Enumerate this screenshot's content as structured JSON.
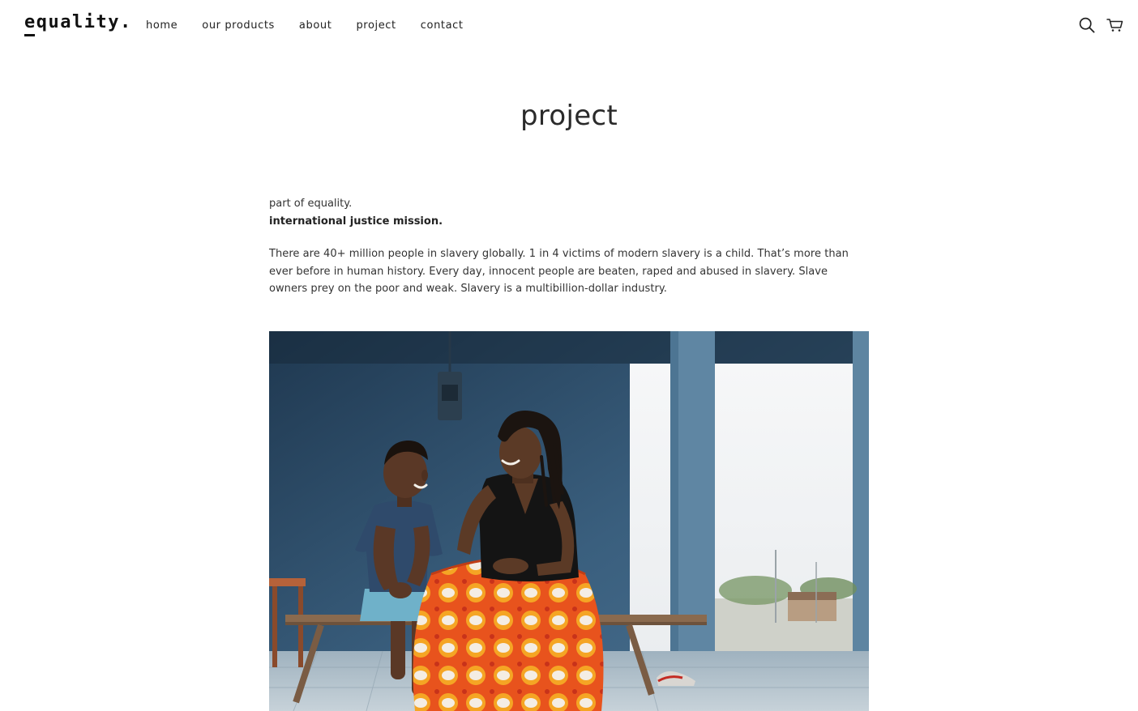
{
  "header": {
    "logo": "equality.",
    "nav": {
      "home": "home",
      "our_products": "our products",
      "about": "about",
      "project": "project",
      "contact": "contact"
    },
    "icons": [
      "search-icon",
      "cart-icon"
    ]
  },
  "main": {
    "title": "project",
    "intro_line": "part of equality.",
    "subtitle": "international justice mission.",
    "body": "There are 40+ million people in slavery globally. 1 in 4 victims of modern slavery is a child. That’s more than ever before in human history. Every day, innocent people are beaten, raped and abused in slavery. Slave owners prey on the poor and weak. Slavery is a multibillion-dollar industry."
  },
  "colors": {
    "text": "#2b2b2b",
    "background": "#ffffff",
    "photo_wall": "#3c5f7d",
    "photo_skirt": "#e8531d"
  }
}
